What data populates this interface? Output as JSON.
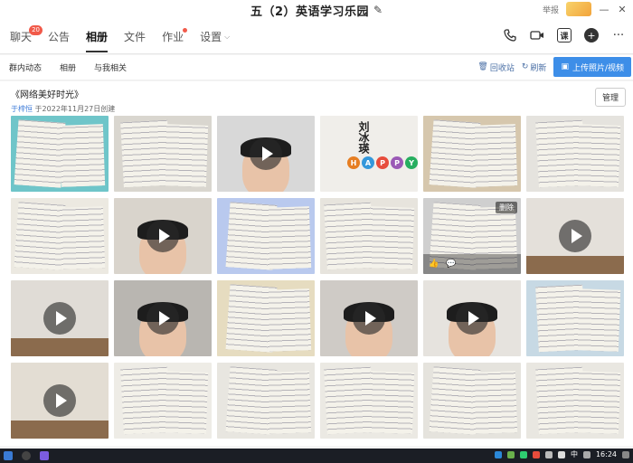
{
  "window": {
    "title": "五（2）英语学习乐园",
    "report_label": "举报",
    "minimize": "—",
    "close": "✕"
  },
  "tabs": [
    {
      "label": "聊天",
      "badge": "20"
    },
    {
      "label": "公告"
    },
    {
      "label": "相册",
      "active": true
    },
    {
      "label": "文件"
    },
    {
      "label": "作业",
      "dot": true
    },
    {
      "label": "设置",
      "dropdown": true
    }
  ],
  "tools": [
    "phone-icon",
    "video-icon",
    "classroom-icon",
    "add-app-icon",
    "more-icon"
  ],
  "tool_glyphs": {
    "classroom": "课",
    "more": "···"
  },
  "subnav": {
    "items": [
      "群内动态",
      "相册",
      "与我相关"
    ],
    "recycle": "回收站",
    "refresh": "刷新",
    "upload": "上传照片/视频"
  },
  "album": {
    "title": "《网络美好时光》",
    "author": "于梓恒",
    "created": "于2022年11月27日创建",
    "manage": "管理"
  },
  "photos": [
    {
      "kind": "paper",
      "video": false,
      "bg": "#6fc5c9"
    },
    {
      "kind": "paper",
      "video": false,
      "bg": "#d9d6cf"
    },
    {
      "kind": "face",
      "video": true,
      "bg": "#d8d8d8"
    },
    {
      "kind": "letters",
      "video": false,
      "bg": "#f0eeea",
      "vtext": "刘冰瑛",
      "letters": "HAPPY"
    },
    {
      "kind": "paper",
      "video": false,
      "bg": "#d6c7ad"
    },
    {
      "kind": "paper",
      "video": false,
      "bg": "#e5e3de"
    },
    {
      "kind": "paper",
      "video": false,
      "bg": "#ece9e1"
    },
    {
      "kind": "face",
      "video": true,
      "bg": "#d9d4cc"
    },
    {
      "kind": "paper",
      "video": false,
      "bg": "#b9c9ee"
    },
    {
      "kind": "paper",
      "video": false,
      "bg": "#e7e4dd"
    },
    {
      "kind": "paper",
      "video": false,
      "bg": "#cfcfcf",
      "overlay": true,
      "delete_label": "删除"
    },
    {
      "kind": "room",
      "video": true,
      "bg": "#e4e0da"
    },
    {
      "kind": "room",
      "video": true,
      "bg": "#e0dcd6"
    },
    {
      "kind": "face",
      "video": true,
      "bg": "#b9b6b1"
    },
    {
      "kind": "paper",
      "video": false,
      "bg": "#e6dcc0"
    },
    {
      "kind": "face",
      "video": true,
      "bg": "#cfcbc6"
    },
    {
      "kind": "face",
      "video": true,
      "bg": "#e6e3de"
    },
    {
      "kind": "paper",
      "video": false,
      "bg": "#c7d9e4"
    },
    {
      "kind": "room",
      "video": true,
      "bg": "#e3ddd3"
    },
    {
      "kind": "paper",
      "video": false,
      "bg": "#eeece6"
    },
    {
      "kind": "paper",
      "video": false,
      "bg": "#e8e6e0"
    },
    {
      "kind": "paper",
      "video": false,
      "bg": "#ebe9e3"
    },
    {
      "kind": "paper",
      "video": false,
      "bg": "#e5e3dd"
    },
    {
      "kind": "paper",
      "video": false,
      "bg": "#e9e7e1"
    }
  ],
  "taskbar": {
    "ime": "中",
    "clock": "16:24"
  },
  "colors": {
    "accent": "#3d8ee8",
    "badge": "#f15a4a"
  }
}
